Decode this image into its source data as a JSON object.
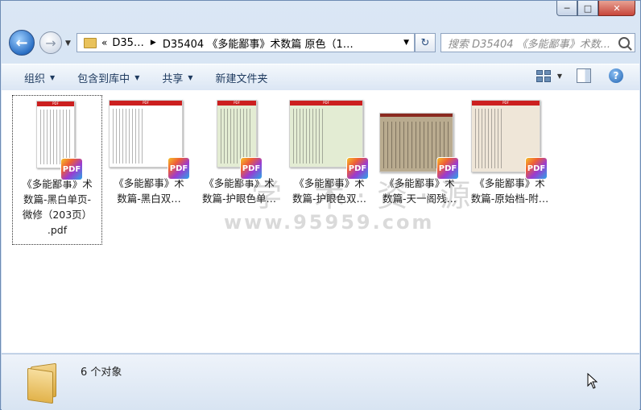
{
  "window": {
    "caption": {
      "minimize": "─",
      "maximize": "□",
      "close": "✕"
    }
  },
  "nav": {
    "back_icon": "back-arrow-icon",
    "forward_icon": "forward-arrow-icon",
    "address": {
      "overflow": "«",
      "crumb1": "D35…",
      "crumb2": "D35404 《多能鄙事》术数篇 原色（1…"
    },
    "search": {
      "placeholder": "搜索 D35404 《多能鄙事》术数..."
    }
  },
  "toolbar": {
    "organize": "组织",
    "include_in_library": "包含到库中",
    "share": "共享",
    "new_folder": "新建文件夹"
  },
  "watermark": {
    "line1": "学·术·资·源",
    "line2": "www.95959.com"
  },
  "files": [
    {
      "name": "《多能鄙事》术数篇-黑白单页-微修（203页）.pdf",
      "label1": "《多能鄙事》术",
      "label2": "数篇-黑白单页-",
      "label3": "微修（203页）",
      "label4": ".pdf",
      "badge": "PDF",
      "thumb_banner": "PDF",
      "thumb_bg": "#ffffff"
    },
    {
      "name": "《多能鄙事》术数篇-黑白双…",
      "label1": "《多能鄙事》术",
      "label2": "数篇-黑白双…",
      "badge": "PDF",
      "thumb_banner": "PDF",
      "thumb_bg": "#ffffff"
    },
    {
      "name": "《多能鄙事》术数篇-护眼色单…",
      "label1": "《多能鄙事》术",
      "label2": "数篇-护眼色单…",
      "badge": "PDF",
      "thumb_banner": "PDF",
      "thumb_bg": "#e3ecd3"
    },
    {
      "name": "《多能鄙事》术数篇-护眼色双…",
      "label1": "《多能鄙事》术",
      "label2": "数篇-护眼色双…",
      "badge": "PDF",
      "thumb_banner": "PDF",
      "thumb_bg": "#e3ecd3"
    },
    {
      "name": "《多能鄙事》术数篇-天一阁残…",
      "label1": "《多能鄙事》术",
      "label2": "数篇-天一阁残…",
      "badge": "PDF",
      "thumb_banner": "",
      "thumb_bg": "#b9ab8f"
    },
    {
      "name": "《多能鄙事》术数篇-原始档-附…",
      "label1": "《多能鄙事》术",
      "label2": "数篇-原始档-附…",
      "badge": "PDF",
      "thumb_banner": "PDF",
      "thumb_bg": "#efe6d8"
    }
  ],
  "status": {
    "count_text": "6 个对象"
  }
}
